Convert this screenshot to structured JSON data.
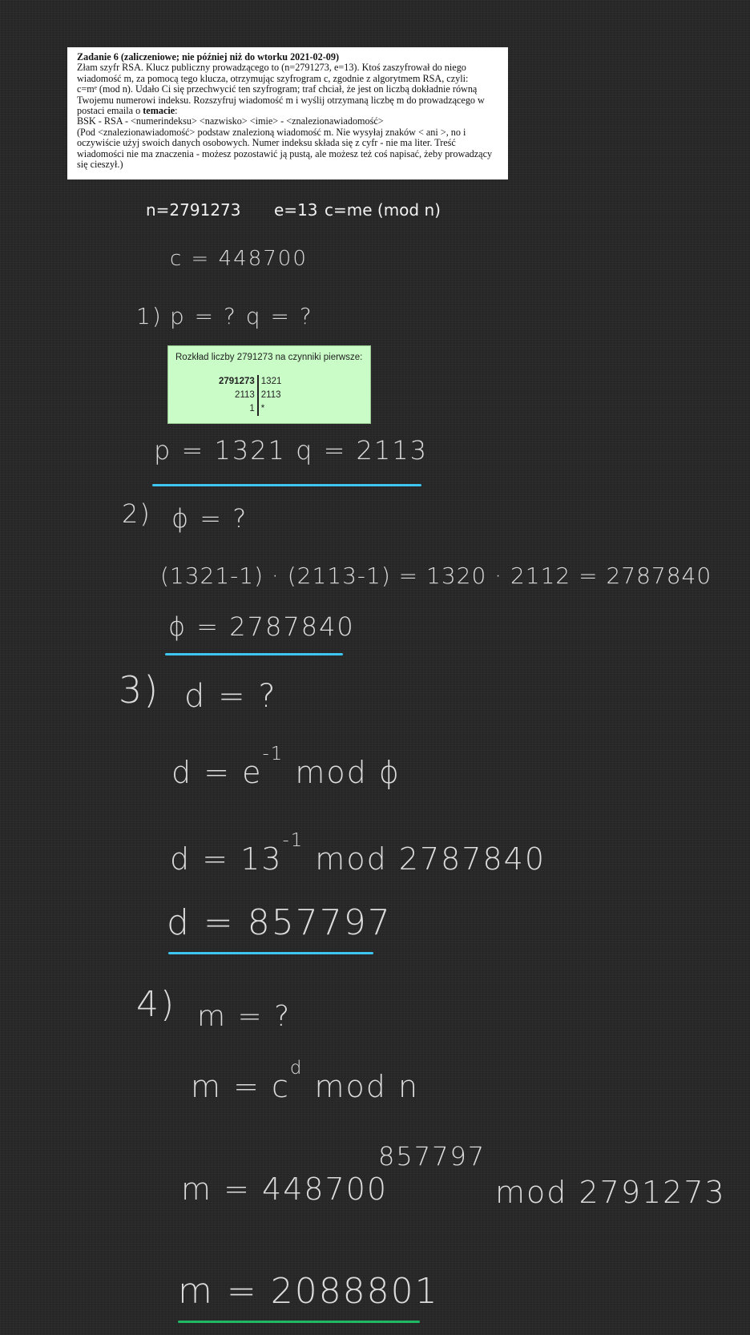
{
  "task": {
    "heading": "Zadanie 6 (zaliczeniowe; nie później niż do wtorku 2021-02-09)",
    "lines": [
      "Złam szyfr RSA. Klucz publiczny prowadzącego to (n=2791273, e=13). Ktoś zaszyfrował do niego",
      "wiadomość m, za pomocą tego klucza, otrzymując szyfrogram c, zgodnie z algorytmem RSA, czyli:",
      "c=mᵉ (mod n). Udało Ci się przechwycić ten szyfrogram; traf chciał, że jest on liczbą dokładnie równą",
      "Twojemu numerowi indeksu. Rozszyfruj wiadomość m i wyślij otrzymaną liczbę m do prowadzącego w"
    ],
    "line5_prefix": "postaci emaila o ",
    "line5_bold": "temacie",
    "line5_suffix": ":",
    "lines_after": [
      "BSK - RSA - <numerindeksu> <nazwisko> <imie> - <znalezionawiadomość>",
      "(Pod <znalezionawiadomość> podstaw znalezioną wiadomość m. Nie wysyłaj znaków < ani >, no i",
      "oczywiście użyj swoich danych osobowych. Numer indeksu składa się z cyfr - nie ma liter. Treść",
      "wiadomości nie ma znaczenia - możesz pozostawić ją pustą, ale możesz też coś napisać, żeby prowadzący",
      "się cieszył.)"
    ]
  },
  "given": {
    "n": "n=2791273",
    "e": "e=13",
    "c_formula": "c=me (mod n)"
  },
  "c_value": "c = 448700",
  "step1": {
    "label": "1)",
    "question": "p = ?    q = ?",
    "result": "p = 1321      q = 2113"
  },
  "factorization": {
    "title": "Rozkład liczby 2791273 na czynniki pierwsze:",
    "rows": [
      {
        "left": "2791273",
        "right": "1321"
      },
      {
        "left": "2113",
        "right": "2113"
      },
      {
        "left": "1",
        "right": "*"
      }
    ]
  },
  "step2": {
    "label": "2)",
    "question": "ϕ = ?",
    "calc": "(1321-1) · (2113-1) = 1320 · 2112 = 2787840",
    "result": "ϕ = 2787840"
  },
  "step3": {
    "label": "3)",
    "question": "d = ?",
    "formula_base": "d =  e",
    "formula_exp": "-1",
    "formula_tail": " mod  ϕ",
    "calc_base": "d = 13",
    "calc_exp": "-1",
    "calc_tail": " mod 2787840",
    "result": "d = 857797"
  },
  "step4": {
    "label": "4)",
    "question": "m = ?",
    "formula_base": "m = c",
    "formula_exp": "d",
    "formula_tail": " mod  n",
    "calc_base": "m = 448700",
    "calc_exp": "857797",
    "calc_tail": "mod 2791273",
    "result": "m = 2088801"
  },
  "colors": {
    "underline_blue": "#3cc6f0",
    "underline_green": "#1fb865",
    "factor_bg": "#c9fcc6",
    "background": "#262626"
  }
}
